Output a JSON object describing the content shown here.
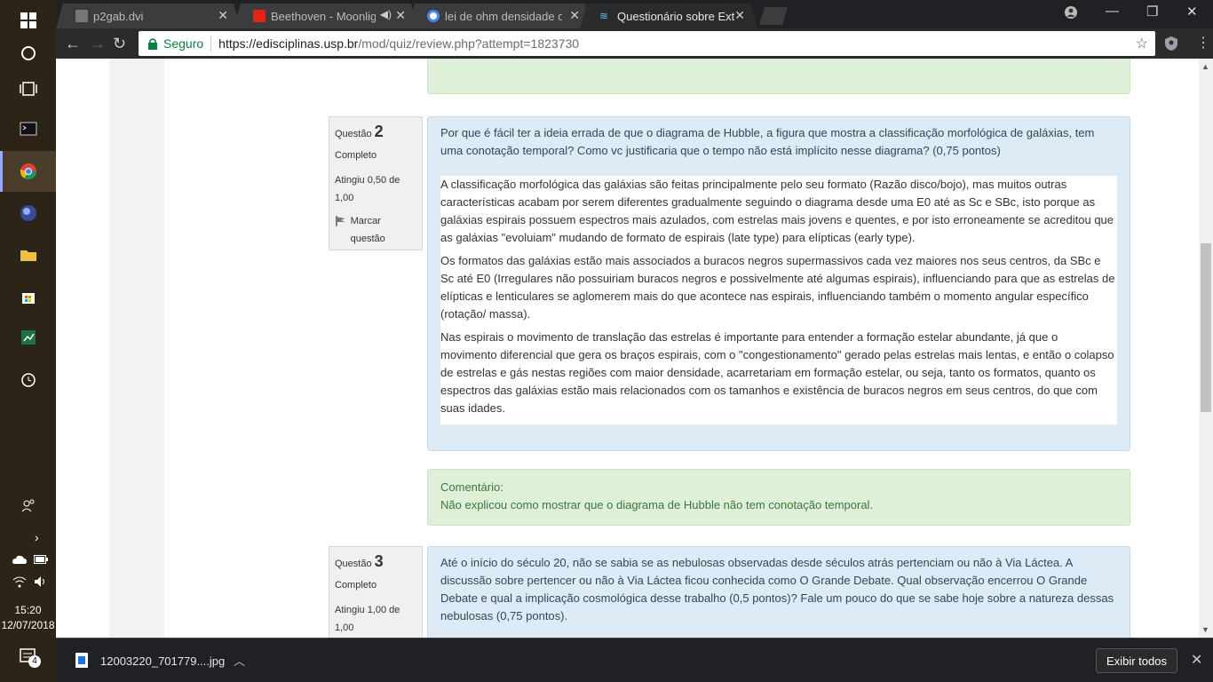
{
  "taskbar": {
    "clock_time": "15:20",
    "clock_date": "12/07/2018",
    "notifications_count": "4"
  },
  "browser": {
    "tabs": [
      {
        "title": "p2gab.dvi"
      },
      {
        "title": "Beethoven - Moonlight"
      },
      {
        "title": "lei de ohm densidade de"
      },
      {
        "title": "Questionário sobre Extra"
      }
    ],
    "secure_label": "Seguro",
    "url_host": "https://edisciplinas.usp.br",
    "url_path": "/mod/quiz/review.php?attempt=1823730"
  },
  "quiz": {
    "q2": {
      "label": "Questão",
      "number": "2",
      "state": "Completo",
      "grade": "Atingiu 0,50 de 1,00",
      "flag": "Marcar questão",
      "text": "Por que é fácil ter a ideia errada de que o diagrama de Hubble, a figura que mostra a classificação morfológica de galáxias, tem uma conotação temporal? Como vc justificaria que o tempo não está implícito nesse diagrama? (0,75 pontos)",
      "answer_p1": "A classificação morfológica das galáxias são feitas principalmente pelo seu formato (Razão disco/bojo), mas muitos  outras características acabam por serem diferentes gradualmente seguindo o diagrama desde uma E0 até as Sc e SBc, isto porque as galáxias espirais possuem espectros mais azulados, com estrelas mais jovens e quentes, e por isto erroneamente se acreditou que as galáxias \"evoluiam\" mudando de formato de espirais (late type)  para elípticas (early type).",
      "answer_p2": "Os formatos das galáxias estão mais associados a buracos negros supermassivos cada vez maiores nos seus centros, da SBc e Sc até E0 (Irregulares não possuiriam buracos negros e possivelmente até algumas espirais), influenciando para que as estrelas de elípticas e lenticulares se aglomerem mais do que acontece nas espirais, influenciando também o momento angular específico (rotação/ massa).",
      "answer_p3": "Nas espirais o movimento de translação das estrelas é importante para entender a formação estelar abundante, já que o movimento diferencial que gera os braços espirais, com o \"congestionamento\" gerado pelas estrelas mais lentas, e então o colapso de estrelas e gás nestas regiões com maior densidade, acarretariam em formação estelar, ou seja, tanto os formatos, quanto os espectros das galáxias estão mais relacionados com os tamanhos e existência de buracos negros em seus centros, do que com suas idades.",
      "comment_label": "Comentário:",
      "comment_text": "Não explicou como mostrar que o diagrama de Hubble não tem conotação temporal."
    },
    "q3": {
      "label": "Questão",
      "number": "3",
      "state": "Completo",
      "grade": "Atingiu 1,00 de 1,00",
      "text": "Até o início do século 20, não se sabia se as nebulosas observadas desde séculos atrás pertenciam ou não à Via Láctea. A discussão sobre pertencer ou não à Via Láctea ficou conhecida como O Grande Debate.  Qual observação encerrou O Grande Debate e qual a implicação cosmológica desse trabalho (0,5 pontos)? Fale um pouco do que se sabe hoje sobre a natureza dessas nebulosas (0,75 pontos)."
    }
  },
  "downloads": {
    "file_name": "12003220_701779....jpg",
    "show_all": "Exibir todos"
  },
  "colors": {
    "question_bg": "#dcebf5",
    "comment_bg": "#dff0d8",
    "secure_green": "#0b8043"
  }
}
